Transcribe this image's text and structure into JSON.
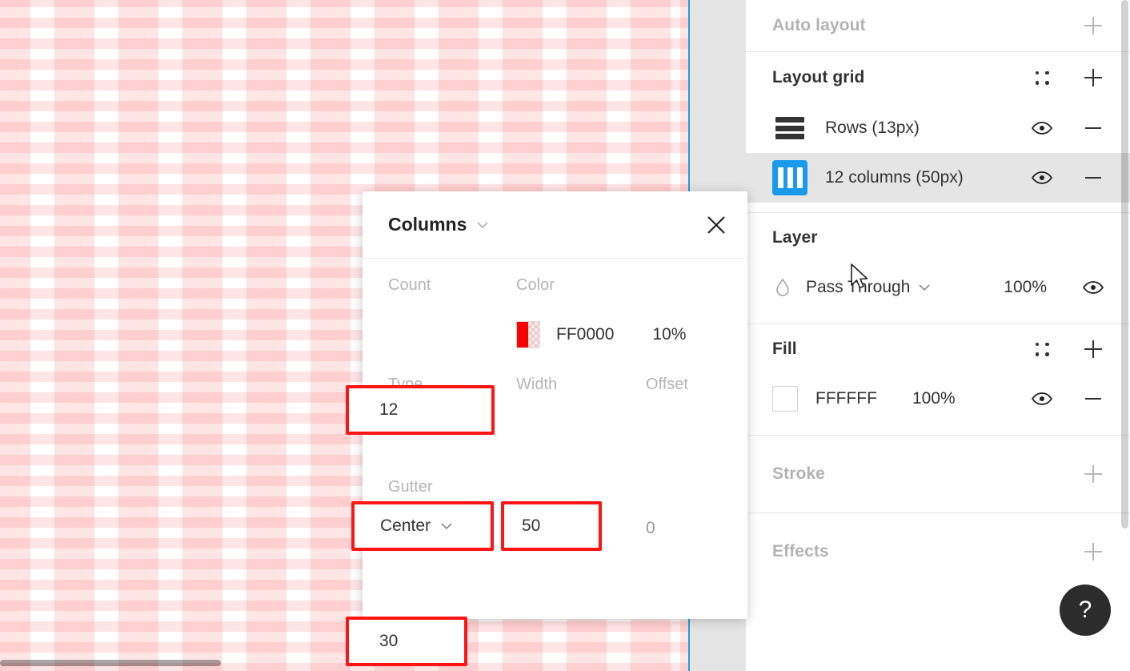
{
  "canvas": {
    "name": "design-canvas",
    "artboard_fill": "#FFFFFF",
    "grid_color": "#FF0000",
    "grid_opacity_percent": "10%",
    "selection_color": "#1E9DE3"
  },
  "dialog": {
    "title": "Columns",
    "close_label": "✕",
    "fields": {
      "count_label": "Count",
      "count_value": "12",
      "color_label": "Color",
      "color_hex": "FF0000",
      "color_opacity": "10%",
      "type_label": "Type",
      "type_value": "Center",
      "width_label": "Width",
      "width_value": "50",
      "offset_label": "Offset",
      "offset_value": "0",
      "gutter_label": "Gutter",
      "gutter_value": "30"
    }
  },
  "panel": {
    "auto_layout": {
      "title": "Auto layout",
      "add_label": "+"
    },
    "layout_grid": {
      "title": "Layout grid",
      "settings_label": "grid-settings",
      "add_label": "+",
      "items": [
        {
          "label": "Rows (13px)",
          "icon": "rows-icon",
          "selected": false
        },
        {
          "label": "12 columns (50px)",
          "icon": "columns-icon",
          "selected": true
        }
      ]
    },
    "layer": {
      "title": "Layer",
      "blend_mode": "Pass Through",
      "opacity": "100%"
    },
    "fill": {
      "title": "Fill",
      "color_hex": "FFFFFF",
      "opacity": "100%"
    },
    "stroke": {
      "title": "Stroke",
      "add_label": "+"
    },
    "effects": {
      "title": "Effects",
      "add_label": "+"
    },
    "help": {
      "label": "?"
    }
  }
}
